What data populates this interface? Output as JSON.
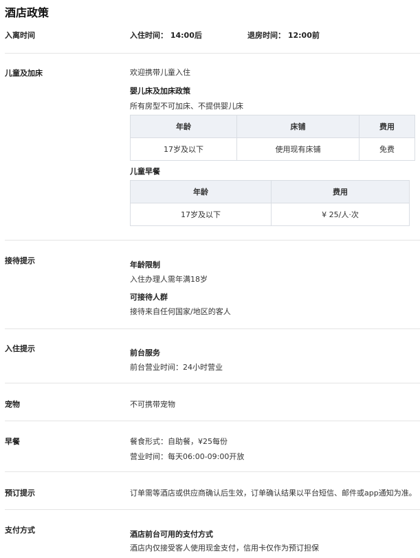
{
  "title": "酒店政策",
  "checkin_section": {
    "label": "入离时间",
    "checkin_text": "入住时间： 14:00后",
    "checkout_text": "退房时间： 12:00前"
  },
  "children_section": {
    "label": "儿童及加床",
    "welcome": "欢迎携带儿童入住",
    "crib_title": "婴儿床及加床政策",
    "crib_desc": "所有房型不可加床、不提供婴儿床",
    "crib_table": {
      "headers": [
        "年龄",
        "床铺",
        "费用"
      ],
      "row": [
        "17岁及以下",
        "使用现有床铺",
        "免费"
      ]
    },
    "breakfast_title": "儿童早餐",
    "breakfast_table": {
      "headers": [
        "年龄",
        "费用"
      ],
      "row": [
        "17岁及以下",
        "¥ 25/人·次"
      ]
    }
  },
  "reception_section": {
    "label": "接待提示",
    "age_title": "年龄限制",
    "age_desc": "入住办理人需年满18岁",
    "guests_title": "可接待人群",
    "guests_desc": "接待来自任何国家/地区的客人"
  },
  "stay_section": {
    "label": "入住提示",
    "desk_title": "前台服务",
    "desk_desc": "前台营业时间：24小时营业"
  },
  "pets_section": {
    "label": "宠物",
    "desc": "不可携带宠物"
  },
  "breakfast_section": {
    "label": "早餐",
    "form": "餐食形式：自助餐，¥25每份",
    "hours": "营业时间：每天06:00-09:00开放"
  },
  "booking_section": {
    "label": "预订提示",
    "desc": "订单需等酒店或供应商确认后生效，订单确认结果以平台短信、邮件或app通知为准。"
  },
  "payment_section": {
    "label": "支付方式",
    "title": "酒店前台可用的支付方式",
    "desc": "酒店内仅接受客人使用现金支付，信用卡仅作为预订担保"
  },
  "colors": {
    "free_text": "#2bb673",
    "table_header_bg": "#eef1f6",
    "divider": "#e4e4e4"
  }
}
